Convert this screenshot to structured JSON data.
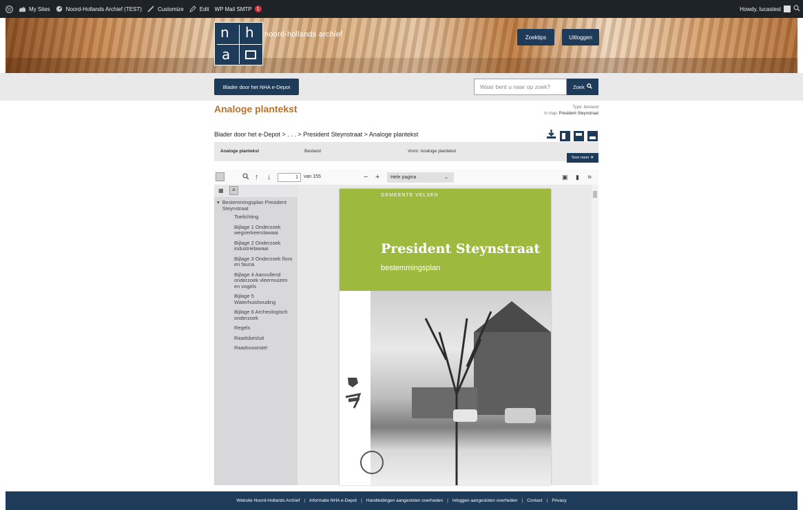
{
  "admin_bar": {
    "my_sites": "My Sites",
    "site_name": "Noord-Hollands Archief (TEST)",
    "customize": "Customize",
    "edit": "Edit",
    "wp_mail": "WP Mail SMTP",
    "wp_mail_badge": "1",
    "howdy": "Howdy, lucastest"
  },
  "header": {
    "logo_letters": [
      "n",
      "h",
      "a"
    ],
    "brand": "noord-hollands archief",
    "zoektips": "Zoektips",
    "uitloggen": "Uitloggen"
  },
  "nav": {
    "browse_button": "Blader door het NHA e-Depot",
    "search_placeholder": "Waar bent u naar op zoek?",
    "search_button": "Zoek"
  },
  "record": {
    "title": "Analoge plantekst",
    "type_label": "Type:",
    "type_value": "bestand",
    "folder_label": "In map:",
    "folder_value": "President Steynstraat",
    "breadcrumb": "Blader door het e-Depot  >  . . .  >  President Steynstraat  >  Analoge plantekst",
    "info_name": "Analoge plantekst",
    "info_kind": "Bestand",
    "info_form": "Vorm: Analoge plantekst",
    "toon_meer": "Toon meer"
  },
  "viewer": {
    "page_number": "1",
    "page_total": "van 155",
    "zoom": "Hele pagina",
    "outline_root": "Bestemmingsplan President Steynstraat",
    "outline_items": [
      "Toelichting",
      "Bijlage 1 Onderzoek wegverkeerslawaai",
      "Bijlage 2 Onderzoek industrielawaai",
      "Bijlage 3 Onderzoek flora en fauna",
      "Bijlage 4 Aanvullend onderzoek vleermuizen en vogels",
      "Bijlage 5 Waterhuishouding",
      "Bijlage 6 Archeologisch onderzoek",
      "Regels",
      "Raadsbesluit",
      "Raadsvoorstel"
    ],
    "doc_municipality": "GEMEENTE VELSEN",
    "doc_title": "President Steynstraat",
    "doc_subtitle": "bestemmingsplan"
  },
  "footer": {
    "links": [
      "Website Noord-Hollands Archief",
      "Informatie NHA e-Depot",
      "Handleidingen aangesloten overheden",
      "Inloggen aangesloten overheden",
      "Contact",
      "Privacy"
    ]
  }
}
